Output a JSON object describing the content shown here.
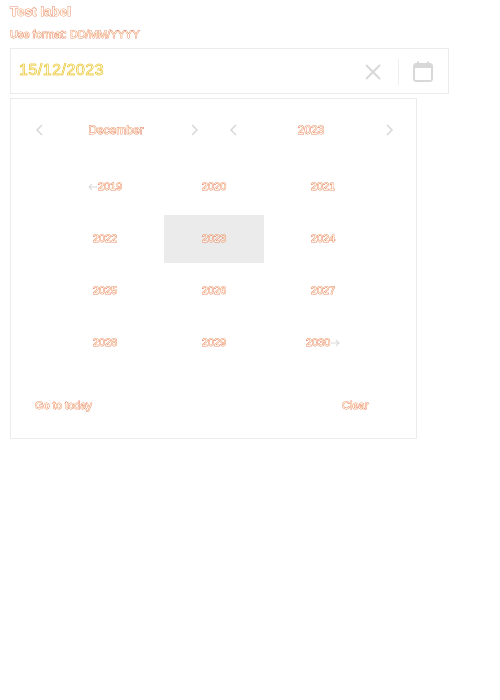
{
  "field": {
    "label": "Test label",
    "helper": "Use format: DD/MM/YYYY",
    "value": "15/12/2023"
  },
  "calendar": {
    "month": "December",
    "year": "2023",
    "years": [
      "2019",
      "2020",
      "2021",
      "2022",
      "2023",
      "2024",
      "2025",
      "2026",
      "2027",
      "2028",
      "2029",
      "2030"
    ],
    "selected_year": "2023",
    "footer": {
      "today": "Go to today",
      "clear": "Clear"
    }
  },
  "icons": {
    "clear": "close-icon",
    "calendar": "calendar-icon",
    "prev": "chevron-left-icon",
    "next": "chevron-right-icon"
  },
  "colors": {
    "text_outline": "#d40000",
    "value_outline": "#e6b800",
    "selected_bg": "#ebebeb",
    "border": "#ececec",
    "icon": "#d8d8d8"
  }
}
